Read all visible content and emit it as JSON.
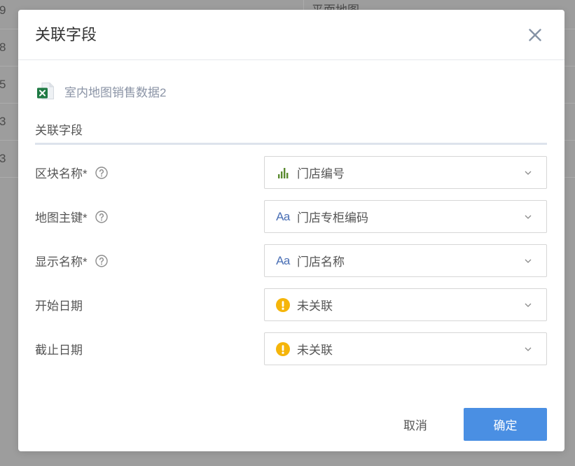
{
  "background_table": {
    "rows": [
      {
        "index": "9",
        "name": "平面地图"
      },
      {
        "index": "8"
      },
      {
        "index": "5"
      },
      {
        "index": "3"
      },
      {
        "index": "3"
      }
    ]
  },
  "dialog": {
    "title": "关联字段",
    "close_icon": "close-icon",
    "source": {
      "icon": "excel-file-icon",
      "name": "室内地图销售数据2"
    },
    "section_title": "关联字段",
    "fields": [
      {
        "label": "区块名称*",
        "help": true,
        "icon": "bar-chart-icon",
        "value": "门店编号"
      },
      {
        "label": "地图主键*",
        "help": true,
        "icon": "text-type-icon",
        "icon_glyph": "Aa",
        "value": "门店专柜编码"
      },
      {
        "label": "显示名称*",
        "help": true,
        "icon": "text-type-icon",
        "icon_glyph": "Aa",
        "value": "门店名称"
      },
      {
        "label": "开始日期",
        "help": false,
        "icon": "warning-icon",
        "value": "未关联"
      },
      {
        "label": "截止日期",
        "help": false,
        "icon": "warning-icon",
        "value": "未关联"
      }
    ],
    "footer": {
      "cancel_label": "取消",
      "confirm_label": "确定"
    }
  },
  "colors": {
    "primary": "#4a8fe3",
    "warning": "#f5b50a",
    "dimension": "#5a8a2f",
    "text_type": "#4a6fb5",
    "excel": "#1f7a44"
  }
}
